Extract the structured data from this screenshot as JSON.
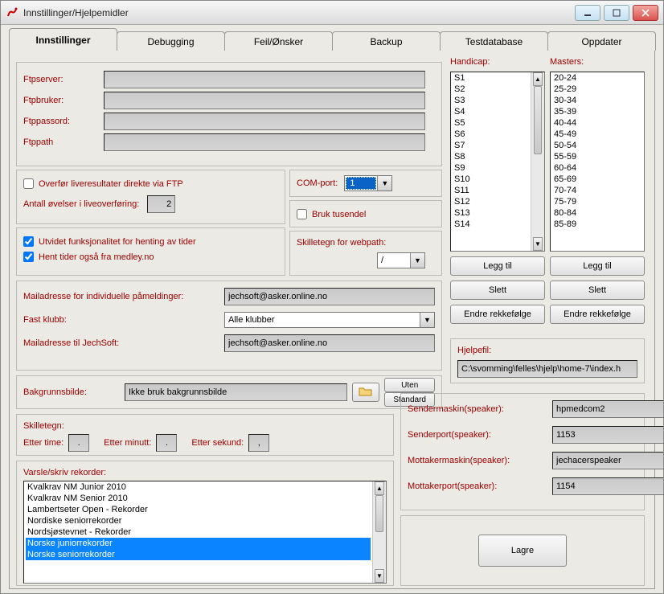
{
  "window": {
    "title": "Innstillinger/Hjelpemidler"
  },
  "tabs": [
    "Innstillinger",
    "Debugging",
    "Feil/Ønsker",
    "Backup",
    "Testdatabase",
    "Oppdater"
  ],
  "ftp": {
    "server_label": "Ftpserver:",
    "bruker_label": "Ftpbruker:",
    "passord_label": "Ftppassord:",
    "path_label": "Ftppath"
  },
  "overfor_live": "Overfør liveresultater direkte via FTP",
  "antall_ovelser_label": "Antall øvelser i liveoverføring:",
  "antall_ovelser": "2",
  "comport_label": "COM-port:",
  "comport_value": "1",
  "bruk_tusendel": "Bruk tusendel",
  "utvidet": "Utvidet funksjonalitet for henting av tider",
  "hent_tider": "Hent tider også fra medley.no",
  "skilletegn_webpath_label": "Skilletegn for webpath:",
  "skilletegn_webpath": "/",
  "mail_ind_label": "Mailadresse for individuelle påmeldinger:",
  "mail_ind": "jechsoft@asker.online.no",
  "fast_klubb_label": "Fast klubb:",
  "fast_klubb": "Alle klubber",
  "mail_jech_label": "Mailadresse til JechSoft:",
  "mail_jech": "jechsoft@asker.online.no",
  "bakgrunn_label": "Bakgrunnsbilde:",
  "bakgrunn": "Ikke bruk bakgrunnsbilde",
  "uten": "Uten",
  "standard": "Standard",
  "handicap_label": "Handicap:",
  "handicap": [
    "S1",
    "S2",
    "S3",
    "S4",
    "S5",
    "S6",
    "S7",
    "S8",
    "S9",
    "S10",
    "S11",
    "S12",
    "S13",
    "S14"
  ],
  "masters_label": "Masters:",
  "masters": [
    "20-24",
    "25-29",
    "30-34",
    "35-39",
    "40-44",
    "45-49",
    "50-54",
    "55-59",
    "60-64",
    "65-69",
    "70-74",
    "75-79",
    "80-84",
    "85-89"
  ],
  "legg_til": "Legg til",
  "slett": "Slett",
  "endre_rekke": "Endre rekkefølge",
  "hjelpefil_label": "Hjelpefil:",
  "hjelpefil": "C:\\svomming\\felles\\hjelp\\home-7\\index.h",
  "skilletegn_label": "Skilletegn:",
  "etter_time": "Etter time:",
  "etter_minutt": "Etter minutt:",
  "etter_sekund": "Etter sekund:",
  "sep_time": ".",
  "sep_min": ".",
  "sep_sek": ",",
  "varsle_label": "Varsle/skriv rekorder:",
  "rekorder": [
    "Kvalkrav NM Junior 2010",
    "Kvalkrav NM Senior 2010",
    "Lambertseter Open - Rekorder",
    "Nordiske seniorrekorder",
    "Nordsjøstevnet - Rekorder",
    "Norske juniorrekorder",
    "Norske seniorrekorder"
  ],
  "sendermaskin_label": "Sendermaskin(speaker):",
  "sendermaskin": "hpmedcom2",
  "senderport_label": "Senderport(speaker):",
  "senderport": "1153",
  "mottakermaskin_label": "Mottakermaskin(speaker):",
  "mottakermaskin": "jechacerspeaker",
  "mottakerport_label": "Mottakerport(speaker):",
  "mottakerport": "1154",
  "lagre": "Lagre"
}
